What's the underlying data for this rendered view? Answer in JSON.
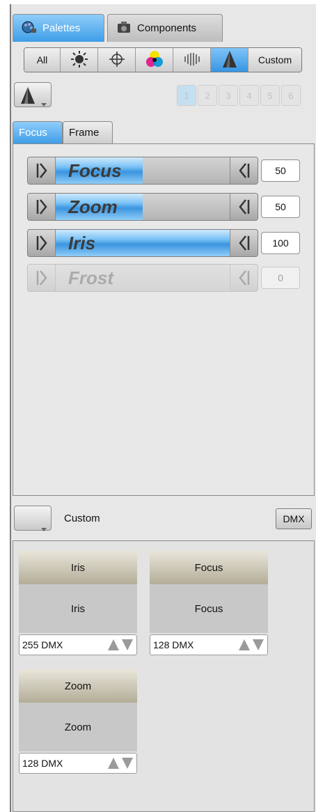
{
  "tabs": {
    "palettes": "Palettes",
    "components": "Components"
  },
  "filter": {
    "all": "All",
    "custom": "Custom",
    "icons": [
      "sun-icon",
      "crosshair-icon",
      "color-icon",
      "gobo-icon",
      "beam-icon"
    ]
  },
  "pages": [
    "1",
    "2",
    "3",
    "4",
    "5",
    "6"
  ],
  "subtabs": {
    "focus": "Focus",
    "frame": "Frame"
  },
  "faders": [
    {
      "label": "Focus",
      "value": "50",
      "level": 0.5
    },
    {
      "label": "Zoom",
      "value": "50",
      "level": 0.5
    },
    {
      "label": "Iris",
      "value": "100",
      "level": 1.0
    },
    {
      "label": "Frost",
      "value": "0",
      "level": 0.0
    }
  ],
  "custom": {
    "label": "Custom",
    "dmx": "DMX"
  },
  "cards": [
    {
      "head": "Iris",
      "body": "Iris",
      "value": "255 DMX"
    },
    {
      "head": "Focus",
      "body": "Focus",
      "value": "128 DMX"
    },
    {
      "head": "Zoom",
      "body": "Zoom",
      "value": "128 DMX"
    }
  ],
  "colors": {
    "accent": "#3f9ee8",
    "card_head": "#c9c4b0"
  }
}
